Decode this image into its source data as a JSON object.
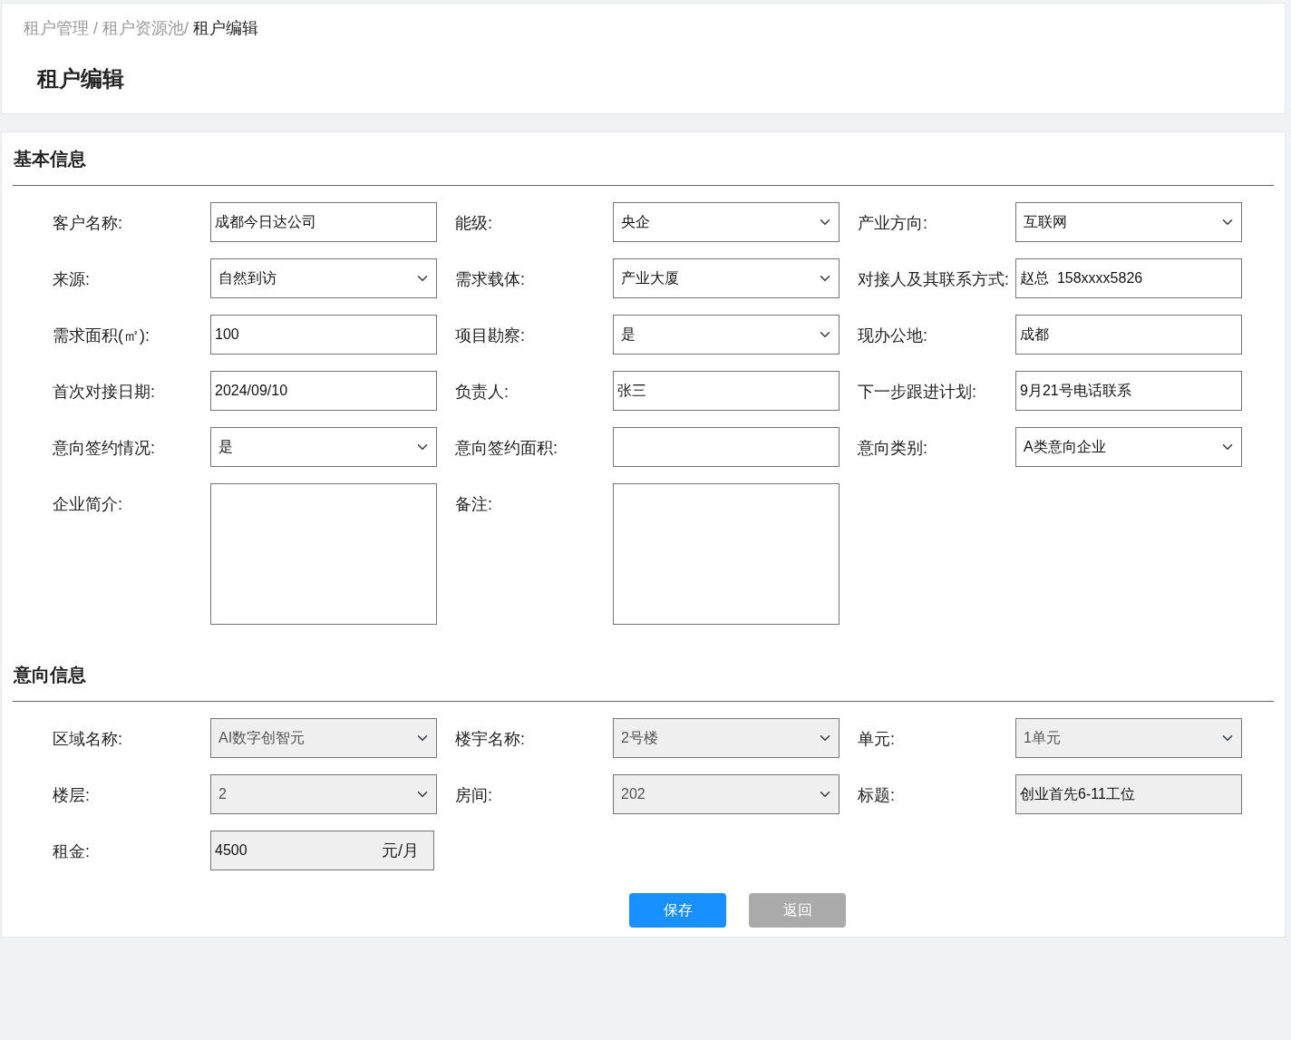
{
  "breadcrumb": {
    "trail": "租户管理 / 租户资源池/",
    "current": "租户编辑"
  },
  "page_title": "租户编辑",
  "sections": [
    {
      "title": "基本信息",
      "fields": [
        {
          "label": "客户名称:",
          "kind": "input",
          "value": "成都今日达公司",
          "disabled": false
        },
        {
          "label": "能级:",
          "kind": "select",
          "value": "央企",
          "disabled": false
        },
        {
          "label": "产业方向:",
          "kind": "select",
          "value": "互联网",
          "disabled": false
        },
        {
          "label": "来源:",
          "kind": "select",
          "value": "自然到访",
          "disabled": false
        },
        {
          "label": "需求载体:",
          "kind": "select",
          "value": "产业大厦",
          "disabled": false
        },
        {
          "label": "对接人及其联系方式:",
          "kind": "input",
          "value": "赵总  158xxxx5826",
          "disabled": false
        },
        {
          "label": "需求面积(㎡):",
          "kind": "input",
          "value": "100",
          "disabled": false
        },
        {
          "label": "项目勘察:",
          "kind": "select",
          "value": "是",
          "disabled": false
        },
        {
          "label": "现办公地:",
          "kind": "input",
          "value": "成都",
          "disabled": false
        },
        {
          "label": "首次对接日期:",
          "kind": "input",
          "value": "2024/09/10",
          "disabled": false
        },
        {
          "label": "负责人:",
          "kind": "input",
          "value": "张三",
          "disabled": false
        },
        {
          "label": "下一步跟进计划:",
          "kind": "input",
          "value": "9月21号电话联系",
          "disabled": false
        },
        {
          "label": "意向签约情况:",
          "kind": "select",
          "value": "是",
          "disabled": false
        },
        {
          "label": "意向签约面积:",
          "kind": "input",
          "disabled": false
        },
        {
          "label": "意向类别:",
          "kind": "select",
          "value": "A类意向企业",
          "disabled": false
        },
        {
          "label": "企业简介:",
          "kind": "textarea",
          "disabled": false
        },
        {
          "label": "备注:",
          "kind": "textarea",
          "disabled": false
        }
      ]
    },
    {
      "title": "意向信息",
      "fields": [
        {
          "label": "区域名称:",
          "kind": "select",
          "value": "AI数字创智元",
          "disabled": true
        },
        {
          "label": "楼宇名称:",
          "kind": "select",
          "value": "2号楼",
          "disabled": true
        },
        {
          "label": "单元:",
          "kind": "select",
          "value": "1单元",
          "disabled": true
        },
        {
          "label": "楼层:",
          "kind": "select",
          "value": "2",
          "disabled": true
        },
        {
          "label": "房间:",
          "kind": "select",
          "value": "202",
          "disabled": true
        },
        {
          "label": "标题:",
          "kind": "input",
          "value": "创业首先6-11工位",
          "disabled": true
        },
        {
          "label": "租金:",
          "kind": "rent",
          "value": "4500",
          "unit": "元/月",
          "disabled": true
        }
      ]
    }
  ],
  "buttons": [
    {
      "label": "保存",
      "kind": "primary"
    },
    {
      "label": "返回",
      "kind": "secondary"
    }
  ]
}
